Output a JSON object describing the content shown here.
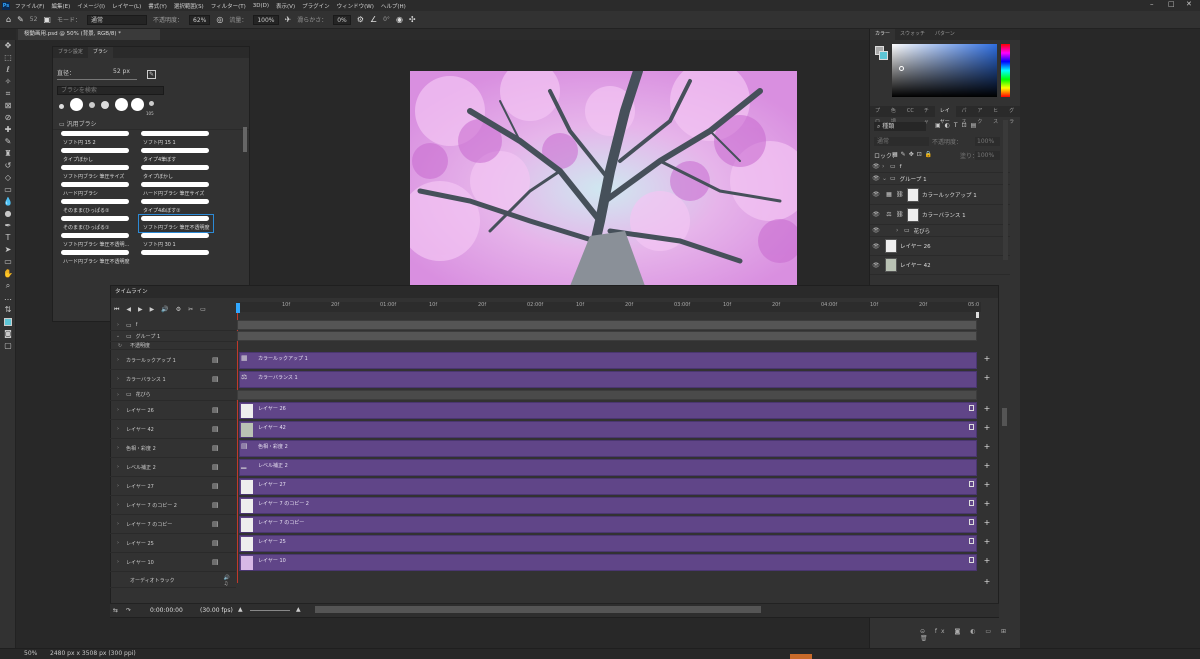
{
  "menu": [
    "ファイル(F)",
    "編集(E)",
    "イメージ(I)",
    "レイヤー(L)",
    "書式(Y)",
    "選択範囲(S)",
    "フィルター(T)",
    "3D(D)",
    "表示(V)",
    "プラグイン",
    "ウィンドウ(W)",
    "ヘルプ(H)"
  ],
  "options": {
    "brush_size": "52",
    "mode_label": "モード：",
    "mode_value": "通常",
    "opacity_label": "不透明度：",
    "opacity_value": "62%",
    "flow_label": "流量：",
    "flow_value": "100%",
    "smooth_label": "滑らかさ：",
    "smooth_value": "0%",
    "angle_value": "0°"
  },
  "doc_tab": "桜動画用.psd @ 50% (背景, RGB/8) *",
  "brush_panel": {
    "tabs": [
      "ブラシ設定",
      "ブラシ"
    ],
    "size_label": "直径：",
    "size_value": "52 px",
    "search_placeholder": "ブラシを検索",
    "presets": [
      "60",
      "100",
      "25",
      "50",
      "30",
      "105"
    ],
    "group": "汎用ブラシ",
    "brushes": [
      [
        "ソフト円 15 2",
        "ソフト円 15 1"
      ],
      [
        "タイプぼかし",
        "タイプ4筆ぼす"
      ],
      [
        "ソフト円ブラシ 筆圧サイズ",
        "タイプぼかし"
      ],
      [
        "ハード円ブラシ",
        "ハード円ブラシ 筆圧サイズ"
      ],
      [
        "そのまま(ひっぱる②",
        "タイプ4ぬぼす②"
      ],
      [
        "そのまま(ひっぱる①",
        "ソフト円ブラシ 筆圧不透明度"
      ],
      [
        "ソフト円ブラシ 筆圧不透明...",
        "ソフト円 30 1"
      ],
      [
        "ハード円ブラシ 筆圧不透明度",
        ""
      ]
    ]
  },
  "color_panel": {
    "tabs": [
      "カラー",
      "スウォッチ",
      "パターン"
    ]
  },
  "layers_panel": {
    "tabs": [
      "プロ",
      "色調",
      "CC",
      "チャ",
      "レイヤー",
      "パス",
      "アク",
      "ヒス",
      "グラ"
    ],
    "filter": "種類",
    "blend": "通常",
    "opacity_label": "不透明度：",
    "opacity": "100%",
    "lock_label": "ロック：",
    "fill_label": "塗り：",
    "fill": "100%",
    "layers": [
      "f",
      "グループ 1",
      "カラールックアップ 1",
      "カラーバランス 1",
      "花びら",
      "レイヤー 26",
      "レイヤー 42"
    ]
  },
  "timeline": {
    "title": "タイムライン",
    "ruler": [
      "10f",
      "20f",
      "01:00f",
      "10f",
      "20f",
      "02:00f",
      "10f",
      "20f",
      "03:00f",
      "10f",
      "20f",
      "04:00f",
      "10f",
      "20f",
      "05:0"
    ],
    "tracks": [
      "f",
      "グループ 1",
      "不透明度",
      "カラールックアップ 1",
      "カラーバランス 1",
      "花びら",
      "レイヤー 26",
      "レイヤー 42",
      "色相・彩度 2",
      "レベル補正 2",
      "レイヤー 27",
      "レイヤー 7 のコピー 2",
      "レイヤー 7 のコピー",
      "レイヤー 25",
      "レイヤー 10",
      "オーディオトラック"
    ],
    "clips": [
      "カラールックアップ 1",
      "カラーバランス 1",
      "レイヤー 26",
      "レイヤー 42",
      "色相・彩度 2",
      "レベル補正 2",
      "レイヤー 27",
      "レイヤー 7 のコピー 2",
      "レイヤー 7 のコピー",
      "レイヤー 25",
      "レイヤー 10"
    ],
    "timecode": "0:00:00:00",
    "fps": "(30.00 fps)"
  },
  "status": {
    "zoom": "50%",
    "size": "2480 px x 3508 px (300 ppi)"
  },
  "colors": {
    "accent": "#31a8ff",
    "clip": "#604588"
  }
}
